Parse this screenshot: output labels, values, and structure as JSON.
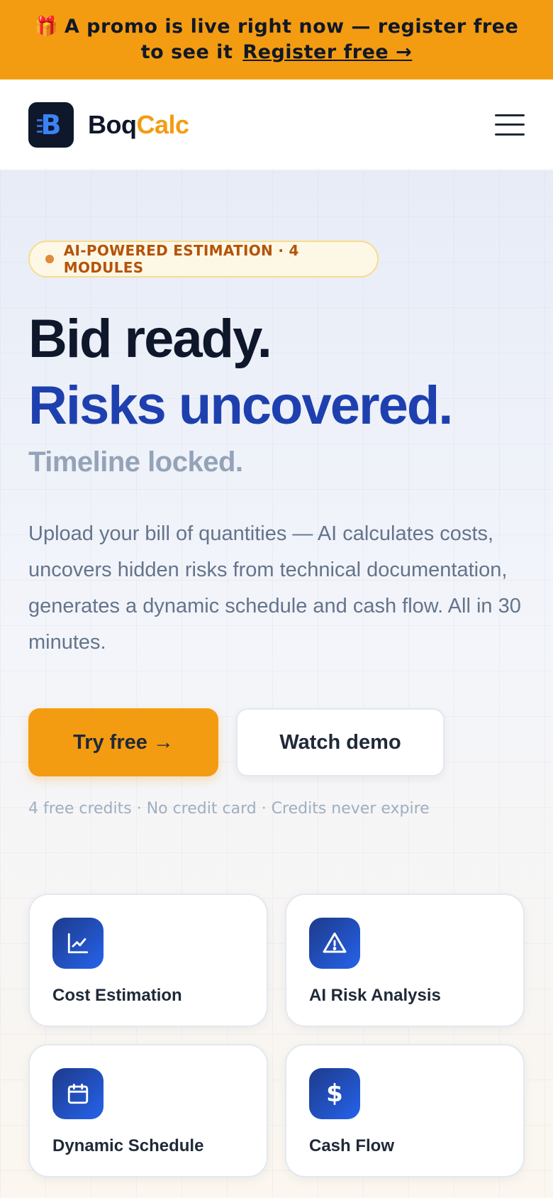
{
  "promo": {
    "gift_icon": "🎁",
    "text": "A promo is live right now — register free to see it",
    "link_label": "Register free →"
  },
  "header": {
    "logo_letter": "B",
    "brand_part1": "Boq",
    "brand_part2": "Calc",
    "menu_icon": "hamburger-menu-icon"
  },
  "hero": {
    "badge": "AI-POWERED ESTIMATION · 4 MODULES",
    "headline_line1": "Bid ready.",
    "headline_line2": "Risks uncovered.",
    "headline_line3": "Timeline locked.",
    "description": "Upload your bill of quantities — AI calculates costs, uncovers hidden risks from technical documentation, generates a dynamic schedule and cash flow. All in 30 minutes.",
    "primary_button": "Try free →",
    "secondary_button": "Watch demo",
    "fine_print": "4 free credits · No credit card · Credits never expire"
  },
  "modules": [
    {
      "label": "Cost Estimation",
      "icon": "line-chart-icon"
    },
    {
      "label": "AI Risk Analysis",
      "icon": "warning-triangle-icon"
    },
    {
      "label": "Dynamic Schedule",
      "icon": "calendar-icon"
    },
    {
      "label": "Cash Flow",
      "icon": "dollar-icon"
    }
  ],
  "colors": {
    "accent": "#f39c12",
    "brand_blue": "#1e40af",
    "dark": "#0f172a"
  }
}
